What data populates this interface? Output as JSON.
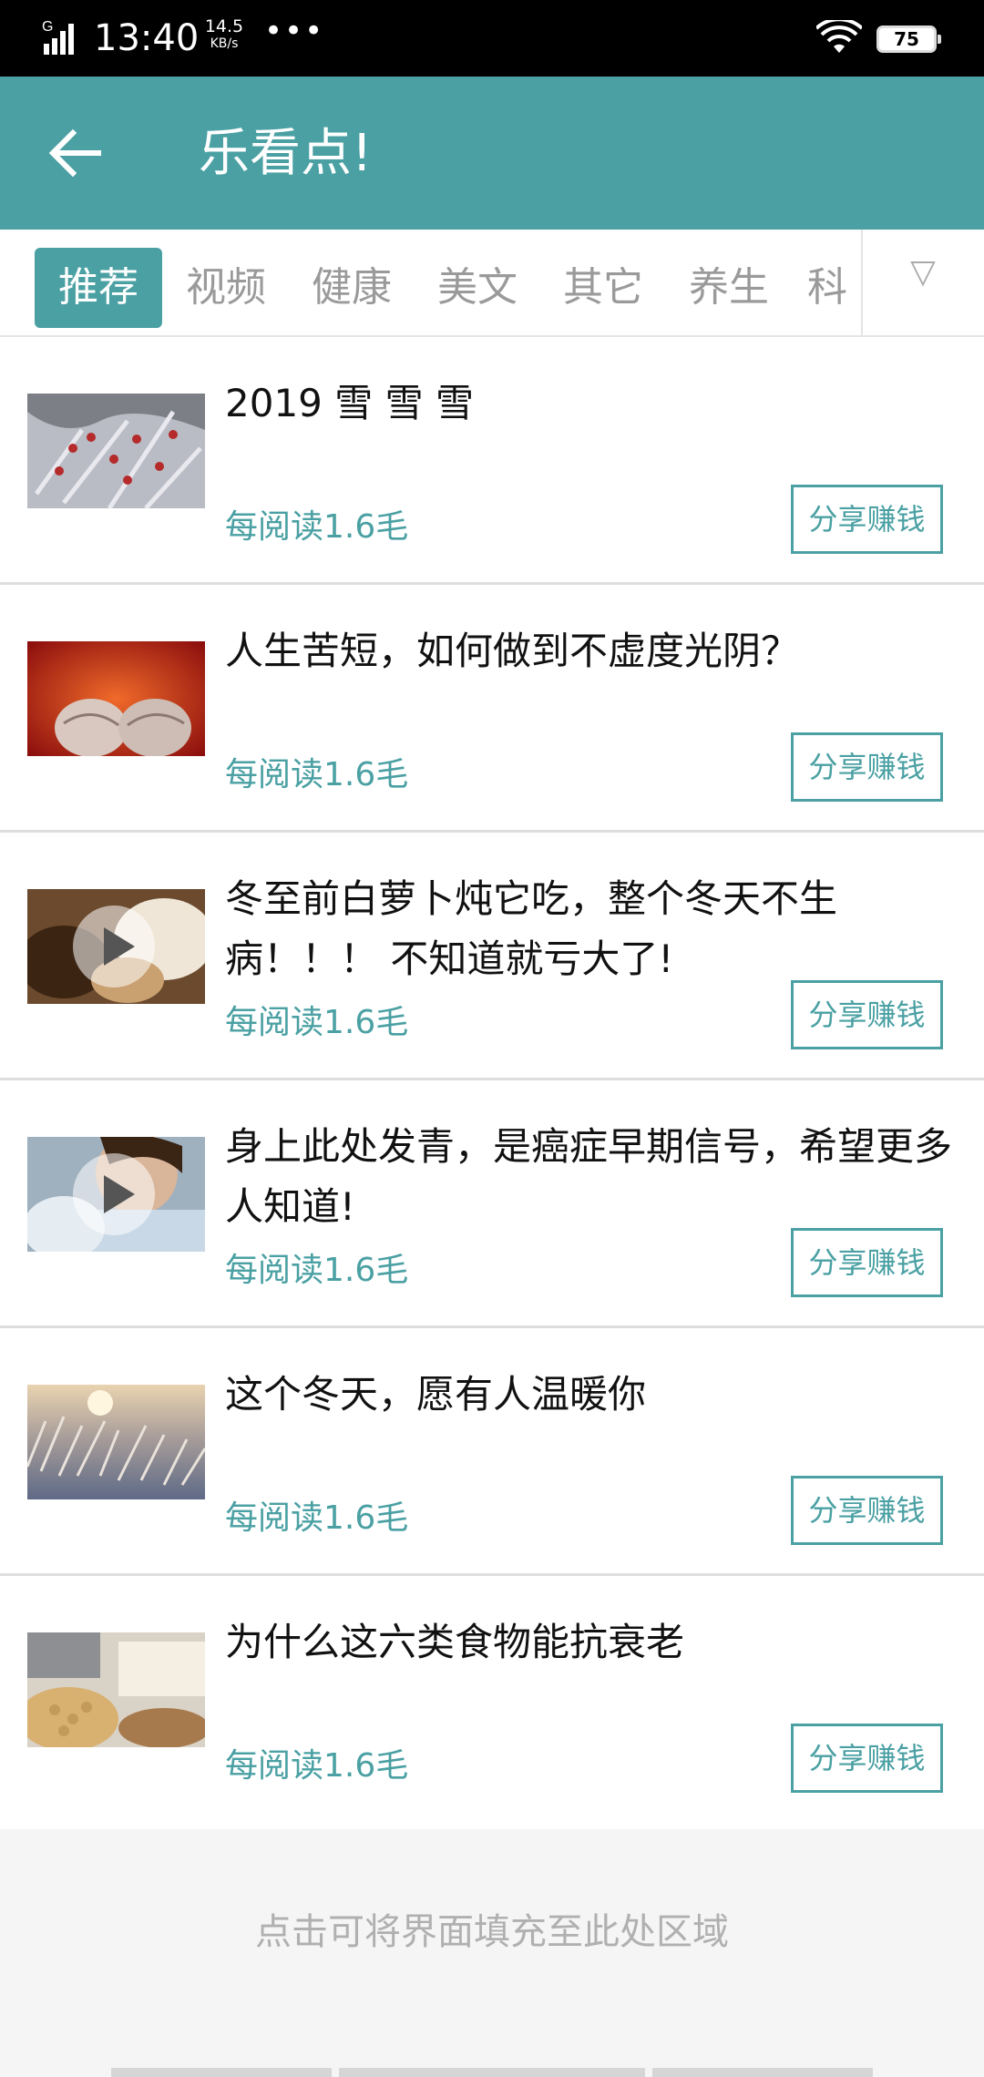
{
  "status_bar": {
    "network": "G",
    "time": "13:40",
    "speed_value": "14.5",
    "speed_unit": "KB/s",
    "more": "•••",
    "battery": "75"
  },
  "app_bar": {
    "back_icon": "arrow-left-icon",
    "title": "乐看点!"
  },
  "tabs": {
    "items": [
      "推荐",
      "视频",
      "健康",
      "美文",
      "其它",
      "养生",
      "科"
    ],
    "active_index": 0,
    "more_icon": "▽"
  },
  "articles": [
    {
      "title": "2019 雪 雪 雪",
      "reward": "每阅读1.6毛",
      "share": "分享赚钱",
      "video": false
    },
    {
      "title": "人生苦短，如何做到不虚度光阴？",
      "reward": "每阅读1.6毛",
      "share": "分享赚钱",
      "video": false
    },
    {
      "title": "冬至前白萝卜炖它吃，整个冬天不生病！！！ 不知道就亏大了!",
      "reward": "每阅读1.6毛",
      "share": "分享赚钱",
      "video": true
    },
    {
      "title": "身上此处发青，是癌症早期信号，希望更多人知道!",
      "reward": "每阅读1.6毛",
      "share": "分享赚钱",
      "video": true
    },
    {
      "title": "这个冬天，愿有人温暖你",
      "reward": "每阅读1.6毛",
      "share": "分享赚钱",
      "video": false
    },
    {
      "title": "为什么这六类食物能抗衰老",
      "reward": "每阅读1.6毛",
      "share": "分享赚钱",
      "video": false
    }
  ],
  "footer": {
    "hint": "点击可将界面填充至此处区域"
  },
  "colors": {
    "accent": "#4aa0a3",
    "status_bar": "#000000",
    "text": "#111111",
    "muted": "#9a9a9a"
  }
}
